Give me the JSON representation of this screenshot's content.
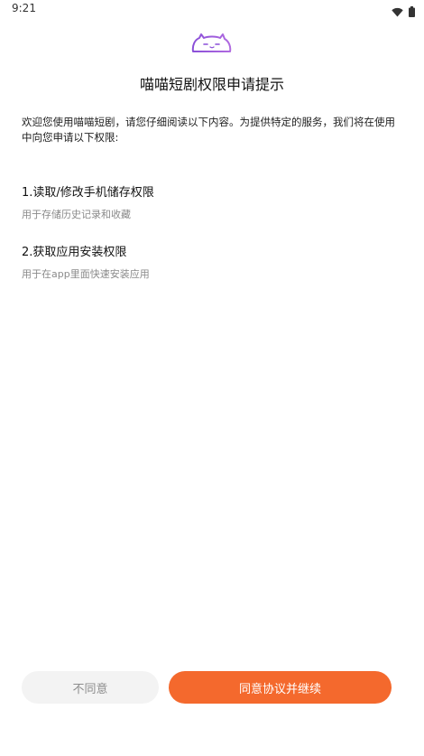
{
  "status_bar": {
    "time": "9:21",
    "icons": [
      "wifi-icon",
      "battery-icon"
    ]
  },
  "header": {
    "logo": "cat-logo-icon",
    "title": "喵喵短剧权限申请提示"
  },
  "intro": {
    "text": "欢迎您使用喵喵短剧，请您仔细阅读以下内容。为提供特定的服务，我们将在使用中向您申请以下权限:"
  },
  "permissions": [
    {
      "title": "1.读取/修改手机储存权限",
      "description": "用于存储历史记录和收藏"
    },
    {
      "title": "2.获取应用安装权限",
      "description": "用于在app里面快速安装应用"
    }
  ],
  "actions": {
    "disagree_label": "不同意",
    "agree_label": "同意协议并继续"
  },
  "colors": {
    "accent": "#f4692d",
    "logo_purple": "#8a4fd8",
    "disagree_bg": "#f3f3f3"
  }
}
